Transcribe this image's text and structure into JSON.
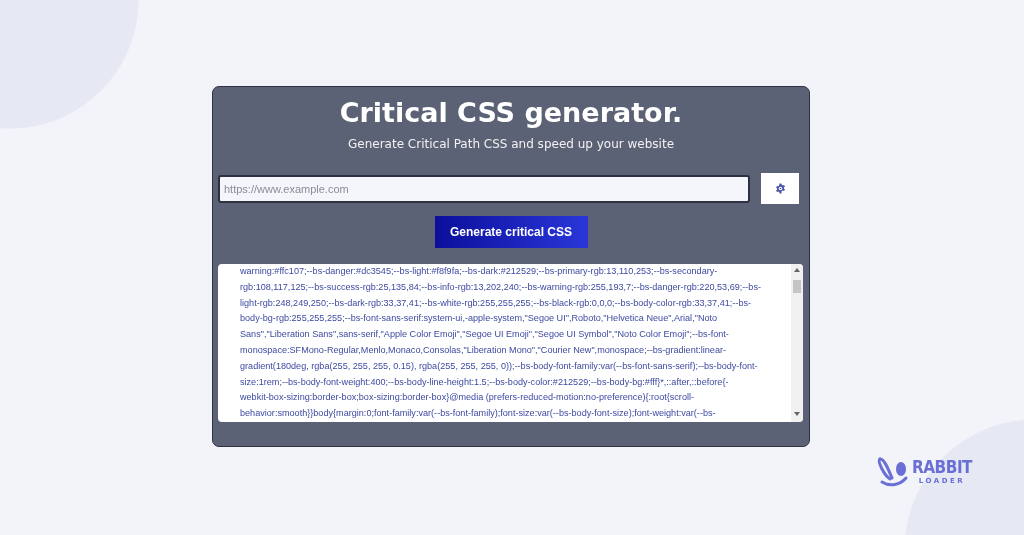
{
  "card": {
    "title": "Critical CSS generator.",
    "subtitle": "Generate Critical Path CSS and speed up your website",
    "url_field": {
      "placeholder": "https://www.example.com"
    },
    "generate_button": "Generate critical CSS",
    "output_lines": [
      "warning:#ffc107;--bs-danger:#dc3545;--bs-light:#f8f9fa;--bs-dark:#212529;--bs-primary-rgb:13,110,253;--bs-secondary-",
      "rgb:108,117,125;--bs-success-rgb:25,135,84;--bs-info-rgb:13,202,240;--bs-warning-rgb:255,193,7;--bs-danger-rgb:220,53,69;--bs-",
      "light-rgb:248,249,250;--bs-dark-rgb:33,37,41;--bs-white-rgb:255,255,255;--bs-black-rgb:0,0,0;--bs-body-color-rgb:33,37,41;--bs-",
      "body-bg-rgb:255,255,255;--bs-font-sans-serif:system-ui,-apple-system,\"Segoe UI\",Roboto,\"Helvetica Neue\",Arial,\"Noto",
      "Sans\",\"Liberation Sans\",sans-serif,\"Apple Color Emoji\",\"Segoe UI Emoji\",\"Segoe UI Symbol\",\"Noto Color Emoji\";--bs-font-",
      "monospace:SFMono-Regular,Menlo,Monaco,Consolas,\"Liberation Mono\",\"Courier New\",monospace;--bs-gradient:linear-",
      "gradient(180deg, rgba(255, 255, 255, 0.15), rgba(255, 255, 255, 0));--bs-body-font-family:var(--bs-font-sans-serif);--bs-body-font-",
      "size:1rem;--bs-body-font-weight:400;--bs-body-line-height:1.5;--bs-body-color:#212529;--bs-body-bg:#fff}*,::after,::before{-",
      "webkit-box-sizing:border-box;box-sizing:border-box}@media (prefers-reduced-motion:no-preference){:root{scroll-",
      "behavior:smooth}}body{margin:0;font-family:var(--bs-font-family);font-size:var(--bs-body-font-size);font-weight:var(--bs-"
    ]
  },
  "logo": {
    "line_1": "RABBIT",
    "line_2": "LOADER"
  }
}
